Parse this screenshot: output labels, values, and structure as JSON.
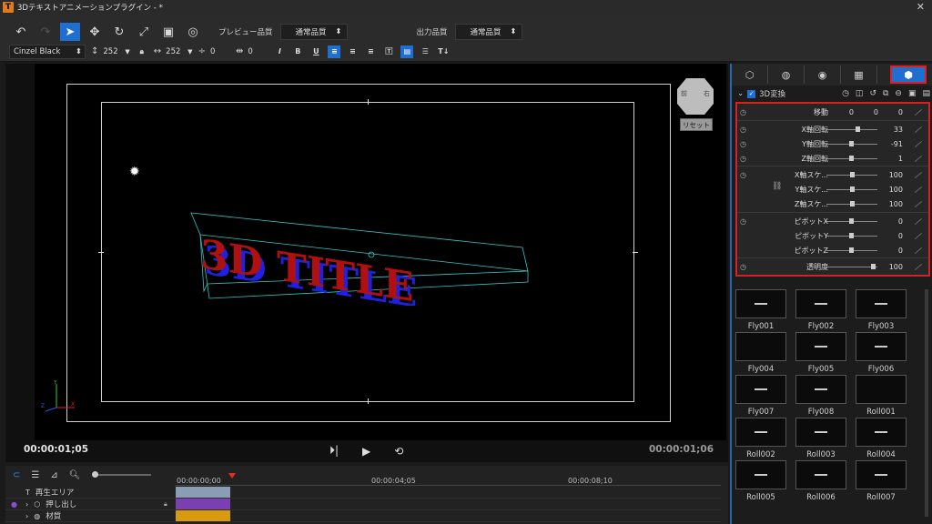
{
  "window": {
    "title": "3Dテキストアニメーションプラグイン - *",
    "app_icon": "T"
  },
  "toolbar": {
    "preview_quality_label": "プレビュー品質",
    "preview_quality_value": "通常品質",
    "output_quality_label": "出力品質",
    "output_quality_value": "通常品質"
  },
  "text_format": {
    "font": "Cinzel Black",
    "size": "252",
    "width": "252",
    "line_spacing": "0",
    "char_spacing": "0",
    "italic_label": "I",
    "bold_label": "B",
    "underline_label": "U"
  },
  "preview": {
    "title_text": "3D TITLE",
    "nav_cube_left": "前",
    "nav_cube_right": "右",
    "reset_label": "リセット",
    "axis_x": "X",
    "axis_y": "Y",
    "axis_z": "Z",
    "current_time": "00:00:01;05",
    "total_time": "00:00:01;06",
    "text_color_front": "#b01010",
    "text_color_side": "#2020e0"
  },
  "timeline": {
    "ruler": [
      "00:00:00;00",
      "00:00:04;05",
      "00:00:08;10"
    ],
    "tracks": [
      {
        "name": "再生エリア",
        "color": "#8a9db3"
      },
      {
        "name": "押し出し",
        "color": "#7a3fb0"
      },
      {
        "name": "材質",
        "color": "#d99a10"
      }
    ]
  },
  "panel": {
    "section_title": "3D変換",
    "params": [
      {
        "name": "移動",
        "v1": "0",
        "v2": "0",
        "v3": "0"
      },
      {
        "name": "X軸回転",
        "value": "33"
      },
      {
        "name": "Y軸回転",
        "value": "-91"
      },
      {
        "name": "Z軸回転",
        "value": "1"
      },
      {
        "name": "X軸スケ...",
        "value": "100"
      },
      {
        "name": "Y軸スケ...",
        "value": "100"
      },
      {
        "name": "Z軸スケ...",
        "value": "100"
      },
      {
        "name": "ピボットX",
        "value": "0"
      },
      {
        "name": "ピボットY",
        "value": "0"
      },
      {
        "name": "ピボットZ",
        "value": "0"
      },
      {
        "name": "透明度",
        "value": "100"
      }
    ],
    "presets": [
      "Fly001",
      "Fly002",
      "Fly003",
      "Fly004",
      "Fly005",
      "Fly006",
      "Fly007",
      "Fly008",
      "Roll001",
      "Roll002",
      "Roll003",
      "Roll004",
      "Roll005",
      "Roll006",
      "Roll007"
    ]
  }
}
